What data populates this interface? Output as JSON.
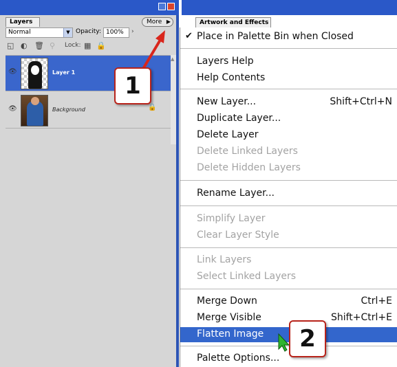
{
  "layers_panel": {
    "tab_label": "Layers",
    "more_label": "More",
    "blend_mode": "Normal",
    "opacity_label": "Opacity:",
    "opacity_value": "100%",
    "lock_label": "Lock:",
    "layers": [
      {
        "name": "Layer 1",
        "selected": true
      },
      {
        "name": "Background",
        "selected": false
      }
    ]
  },
  "artwork_panel": {
    "tab_label": "Artwork and Effects"
  },
  "menu": {
    "items": [
      {
        "label": "Place in Palette Bin when Closed",
        "checked": true,
        "disabled": false
      },
      {
        "label": "Layers Help",
        "disabled": false
      },
      {
        "label": "Help Contents",
        "disabled": false
      },
      {
        "label": "New Layer...",
        "shortcut": "Shift+Ctrl+N",
        "disabled": false
      },
      {
        "label": "Duplicate Layer...",
        "disabled": false
      },
      {
        "label": "Delete Layer",
        "disabled": false
      },
      {
        "label": "Delete Linked Layers",
        "disabled": true
      },
      {
        "label": "Delete Hidden Layers",
        "disabled": true
      },
      {
        "label": "Rename Layer...",
        "disabled": false
      },
      {
        "label": "Simplify Layer",
        "disabled": true
      },
      {
        "label": "Clear Layer Style",
        "disabled": true
      },
      {
        "label": "Link Layers",
        "disabled": true
      },
      {
        "label": "Select Linked Layers",
        "disabled": true
      },
      {
        "label": "Merge Down",
        "shortcut": "Ctrl+E",
        "disabled": false
      },
      {
        "label": "Merge Visible",
        "shortcut": "Shift+Ctrl+E",
        "disabled": false
      },
      {
        "label": "Flatten Image",
        "disabled": false,
        "highlighted": true
      },
      {
        "label": "Palette Options...",
        "disabled": false
      }
    ]
  },
  "annotations": {
    "step1": "1",
    "step2": "2",
    "callout_color": "#b8231a",
    "highlight_color": "#3366cc"
  }
}
